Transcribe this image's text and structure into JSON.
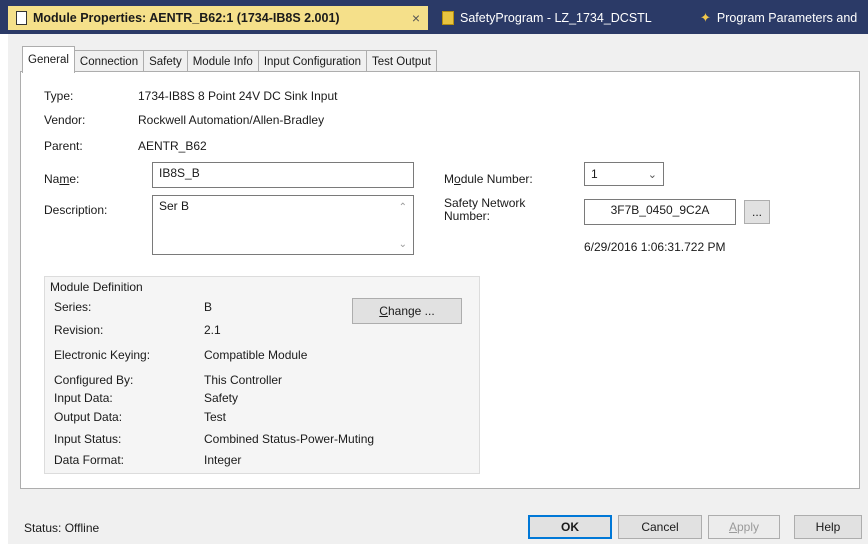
{
  "doc_tabs": [
    {
      "label": "Module Properties: AENTR_B62:1 (1734-IB8S 2.001)",
      "close": "×"
    },
    {
      "label": "SafetyProgram - LZ_1734_DCSTL"
    },
    {
      "label": "Program Parameters and"
    }
  ],
  "prop_tabs": [
    "General",
    "Connection",
    "Safety",
    "Module Info",
    "Input Configuration",
    "Test Output"
  ],
  "general": {
    "type_label": "Type:",
    "type_value": "1734-IB8S 8 Point 24V DC Sink Input",
    "vendor_label": "Vendor:",
    "vendor_value": "Rockwell Automation/Allen-Bradley",
    "parent_label": "Parent:",
    "parent_value": "AENTR_B62",
    "name_label_pre": "Na",
    "name_label_acc": "m",
    "name_label_post": "e:",
    "name_value": "IB8S_B",
    "description_label": "Description:",
    "description_value": "Ser B",
    "module_number_label_pre": "M",
    "module_number_label_acc": "o",
    "module_number_label_post": "dule Number:",
    "module_number_value": "1",
    "safety_network_label_1": "Safety Network",
    "safety_network_label_2": "Number:",
    "safety_network_value": "3F7B_0450_9C2A",
    "safety_network_button": "...",
    "timestamp": "6/29/2016 1:06:31.722 PM"
  },
  "module_definition": {
    "title": "Module Definition",
    "change_button_pre": "",
    "change_button_acc": "C",
    "change_button_post": "hange ...",
    "rows": [
      {
        "label": "Series:",
        "value": "B"
      },
      {
        "label": "Revision:",
        "value": "2.1"
      },
      {
        "label": "Electronic Keying:",
        "value": "Compatible Module"
      },
      {
        "label": "Configured By:",
        "value": "This Controller"
      },
      {
        "label": "Input Data:",
        "value": "Safety"
      },
      {
        "label": "Output Data:",
        "value": "Test"
      },
      {
        "label": "Input Status:",
        "value": "Combined Status-Power-Muting"
      },
      {
        "label": "Data Format:",
        "value": "Integer"
      }
    ]
  },
  "status": {
    "label": "Status:",
    "value": "Offline"
  },
  "buttons": {
    "ok": "OK",
    "cancel": "Cancel",
    "apply_acc": "A",
    "apply_post": "pply",
    "help": "Help"
  },
  "colors": {
    "tabstrip": "#2b3a67",
    "active_doc_tab": "#f5e08a"
  }
}
